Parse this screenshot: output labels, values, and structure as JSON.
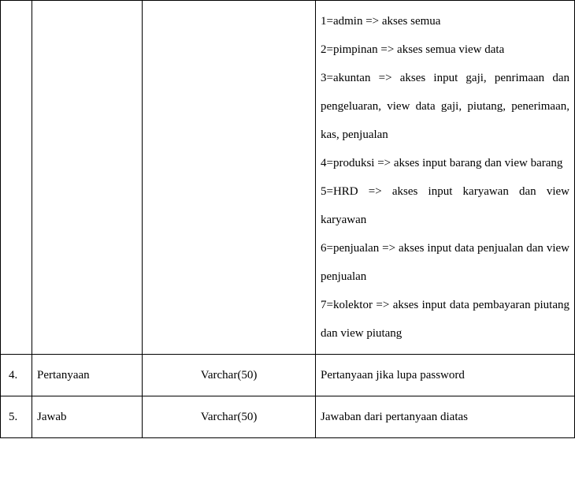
{
  "rows": [
    {
      "no": "",
      "name": "",
      "type": "",
      "desc_lines": [
        "1=admin => akses semua",
        "2=pimpinan    => akses semua view data",
        "3=akuntan   =>   akses   input   gaji, penrimaan dan pengeluaran, view data gaji, piutang, penerimaan, kas, penjualan",
        "4=produksi    => akses input barang dan view barang",
        "5=HRD            =>    akses   input  karyawan dan view karyawan",
        "6=penjualan  =>  akses  input  data penjualan dan view penjualan",
        "7=kolektor   =>   akses   input   data  pembayaran piutang dan view piutang"
      ]
    },
    {
      "no": "4.",
      "name": "Pertanyaan",
      "type": "Varchar(50)",
      "desc_lines": [
        "Pertanyaan jika lupa password"
      ]
    },
    {
      "no": "5.",
      "name": "Jawab",
      "type": "Varchar(50)",
      "desc_lines": [
        "Jawaban dari pertanyaan diatas"
      ]
    }
  ]
}
